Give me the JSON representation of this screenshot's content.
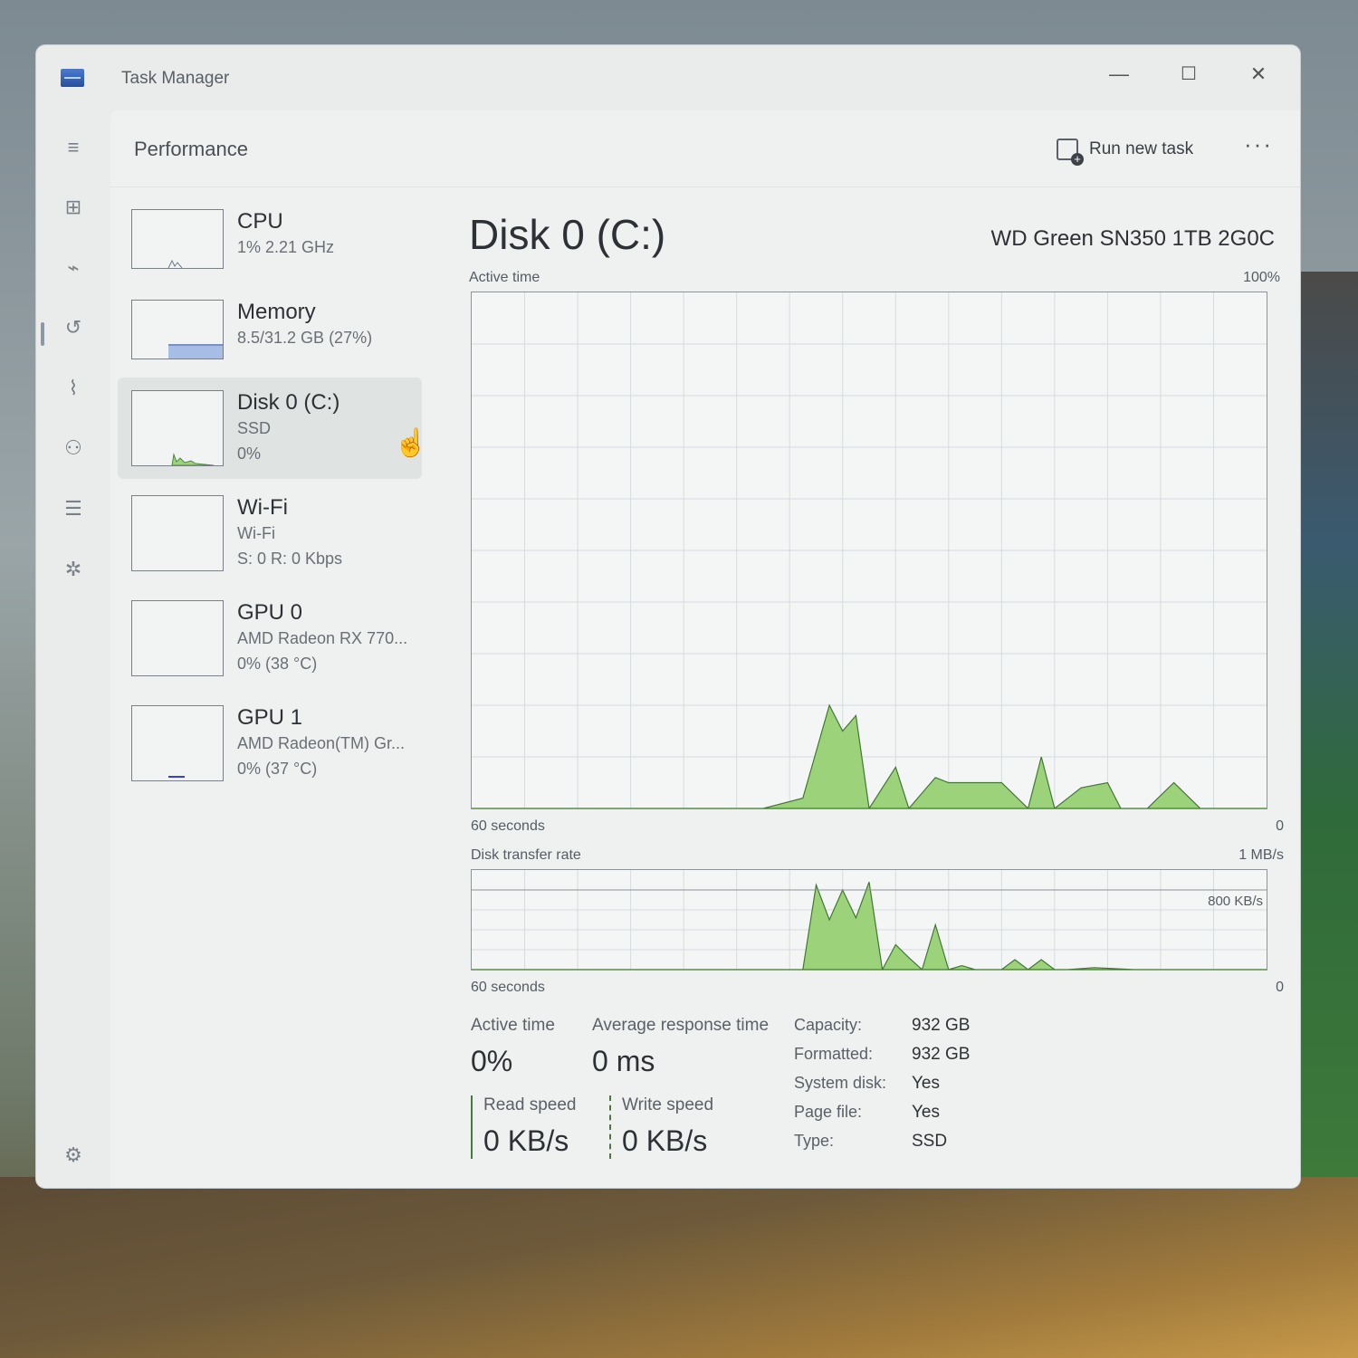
{
  "window": {
    "title": "Task Manager",
    "icon": "task-manager-icon"
  },
  "titlebar_buttons": {
    "minimize": "—",
    "maximize": "☐",
    "close": "✕"
  },
  "rail_icons": [
    "hamburger-icon",
    "processes-icon",
    "performance-icon",
    "app-history-icon",
    "startup-apps-icon",
    "users-icon",
    "details-icon",
    "services-icon",
    "settings-icon"
  ],
  "header": {
    "title": "Performance",
    "run_new_task": "Run new task",
    "more": "···"
  },
  "sidebar": {
    "items": [
      {
        "title": "CPU",
        "sub1": "1% 2.21 GHz",
        "sub2": ""
      },
      {
        "title": "Memory",
        "sub1": "8.5/31.2 GB (27%)",
        "sub2": ""
      },
      {
        "title": "Disk 0 (C:)",
        "sub1": "SSD",
        "sub2": "0%"
      },
      {
        "title": "Wi-Fi",
        "sub1": "Wi-Fi",
        "sub2": "S: 0 R: 0 Kbps"
      },
      {
        "title": "GPU 0",
        "sub1": "AMD Radeon RX 770...",
        "sub2": "0% (38 °C)"
      },
      {
        "title": "GPU 1",
        "sub1": "AMD Radeon(TM) Gr...",
        "sub2": "0% (37 °C)"
      }
    ]
  },
  "main": {
    "title": "Disk 0 (C:)",
    "model": "WD Green SN350 1TB 2G0C",
    "active_chart": {
      "label": "Active time",
      "max": "100%",
      "x_left": "60 seconds",
      "x_right": "0"
    },
    "transfer_chart": {
      "label": "Disk transfer rate",
      "max": "1 MB/s",
      "mid": "800 KB/s",
      "x_left": "60 seconds",
      "x_right": "0"
    },
    "stats": {
      "active_time_label": "Active time",
      "active_time": "0%",
      "avg_resp_label": "Average response time",
      "avg_resp": "0 ms",
      "read_label": "Read speed",
      "read": "0 KB/s",
      "write_label": "Write speed",
      "write": "0 KB/s"
    },
    "props": [
      {
        "k": "Capacity:",
        "v": "932 GB"
      },
      {
        "k": "Formatted:",
        "v": "932 GB"
      },
      {
        "k": "System disk:",
        "v": "Yes"
      },
      {
        "k": "Page file:",
        "v": "Yes"
      },
      {
        "k": "Type:",
        "v": "SSD"
      }
    ]
  },
  "chart_data": [
    {
      "type": "area",
      "title": "Active time",
      "x": [
        60,
        53,
        46,
        42,
        40,
        38,
        35,
        33,
        32,
        31,
        30,
        28,
        27,
        25,
        24,
        22,
        20,
        18,
        17,
        16,
        14,
        12,
        11,
        9,
        7,
        5,
        4,
        0
      ],
      "values": [
        0,
        0,
        0,
        0,
        0,
        0,
        2,
        20,
        15,
        18,
        0,
        8,
        0,
        6,
        5,
        5,
        5,
        0,
        10,
        0,
        4,
        5,
        0,
        0,
        5,
        0,
        0,
        0
      ],
      "ylim": [
        0,
        100
      ],
      "xlim": [
        60,
        0
      ],
      "grid": true,
      "color": "#9cd37a"
    },
    {
      "type": "area",
      "title": "Disk transfer rate",
      "x": [
        60,
        35,
        34,
        33,
        32,
        31,
        30,
        29,
        28,
        27,
        26,
        25,
        24,
        23,
        22,
        21,
        20,
        19,
        18,
        17,
        16,
        15,
        13,
        10,
        8,
        0
      ],
      "values": [
        0,
        0,
        850,
        500,
        800,
        520,
        880,
        0,
        250,
        120,
        0,
        450,
        0,
        40,
        0,
        0,
        0,
        100,
        0,
        100,
        0,
        0,
        20,
        0,
        0,
        0
      ],
      "ylim": [
        0,
        1000
      ],
      "xlim": [
        60,
        0
      ],
      "grid": true,
      "color": "#9cd37a"
    }
  ]
}
